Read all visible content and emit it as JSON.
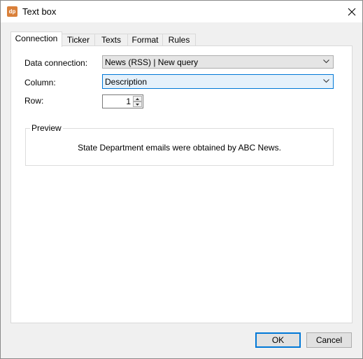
{
  "window": {
    "title": "Text box",
    "icon_text": "dp",
    "icon_color": "#d9803a",
    "close_icon": "close-icon"
  },
  "tabs": [
    {
      "label": "Connection",
      "active": true
    },
    {
      "label": "Ticker",
      "active": false
    },
    {
      "label": "Texts",
      "active": false
    },
    {
      "label": "Format",
      "active": false
    },
    {
      "label": "Rules",
      "active": false
    }
  ],
  "form": {
    "data_connection_label": "Data connection:",
    "data_connection_value": "News (RSS) | New query",
    "column_label": "Column:",
    "column_value": "Description",
    "row_label": "Row:",
    "row_value": "1"
  },
  "preview": {
    "legend": "Preview",
    "text": "State Department emails were obtained by ABC News."
  },
  "buttons": {
    "ok": "OK",
    "cancel": "Cancel"
  },
  "colors": {
    "focus": "#0078d7",
    "focus_fill": "#e5f1fb"
  }
}
